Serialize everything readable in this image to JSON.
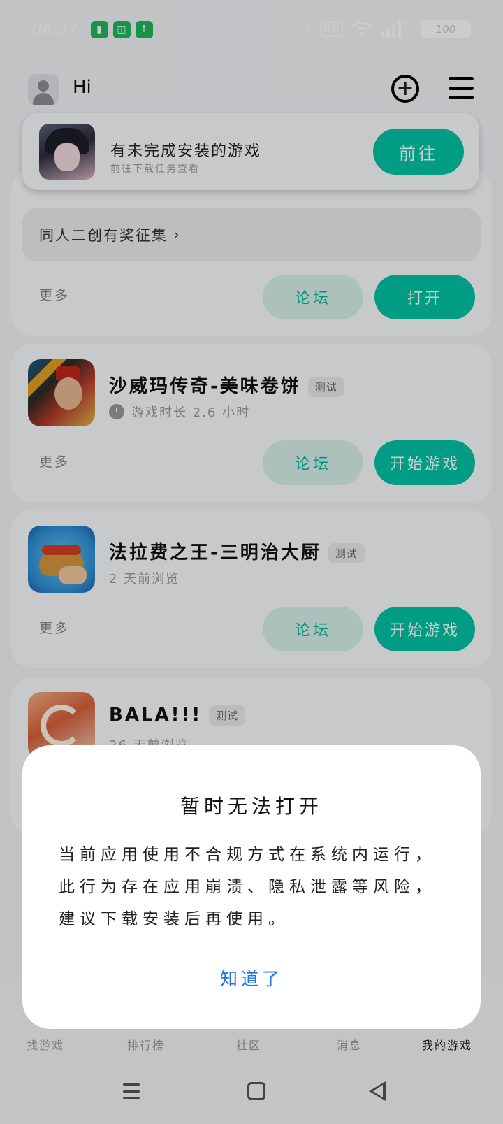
{
  "status_bar": {
    "time": "06:37",
    "hd_label": "HD",
    "network_label": "5G",
    "battery": "100"
  },
  "header": {
    "greeting": "Hi"
  },
  "banner": {
    "title": "有未完成安装的游戏",
    "subtitle": "前往下载任务查看",
    "button": "前往"
  },
  "cards": [
    {
      "campaign": "同人二创有奖征集",
      "more": "更多",
      "forum": "论坛",
      "action": "打开"
    },
    {
      "title": "沙威玛传奇-美味卷饼",
      "tag": "测试",
      "subtitle": "游戏时长 2.6 小时",
      "more": "更多",
      "forum": "论坛",
      "action": "开始游戏"
    },
    {
      "title": "法拉费之王-三明治大厨",
      "tag": "测试",
      "subtitle": "2 天前浏览",
      "more": "更多",
      "forum": "论坛",
      "action": "开始游戏"
    },
    {
      "title": "BALA!!!",
      "tag": "测试",
      "subtitle": "26 天前浏览"
    }
  ],
  "dialog": {
    "title": "暂时无法打开",
    "body": "当前应用使用不合规方式在系统内运行，此行为存在应用崩溃、隐私泄露等风险，建议下载安装后再使用。",
    "button": "知道了"
  },
  "bottom_nav": [
    {
      "label": "找游戏",
      "active": false
    },
    {
      "label": "排行榜",
      "active": false
    },
    {
      "label": "社区",
      "active": false
    },
    {
      "label": "消息",
      "active": false
    },
    {
      "label": "我的游戏",
      "active": true
    }
  ],
  "colors": {
    "accent": "#00c3a6",
    "accent_light": "#d8f1ec",
    "dialog_button": "#1f76e8"
  },
  "icons": [
    "bluetooth-icon",
    "wifi-icon",
    "add-circle-icon",
    "hamburger-menu-icon",
    "timer-icon",
    "chevron-right-icon"
  ]
}
